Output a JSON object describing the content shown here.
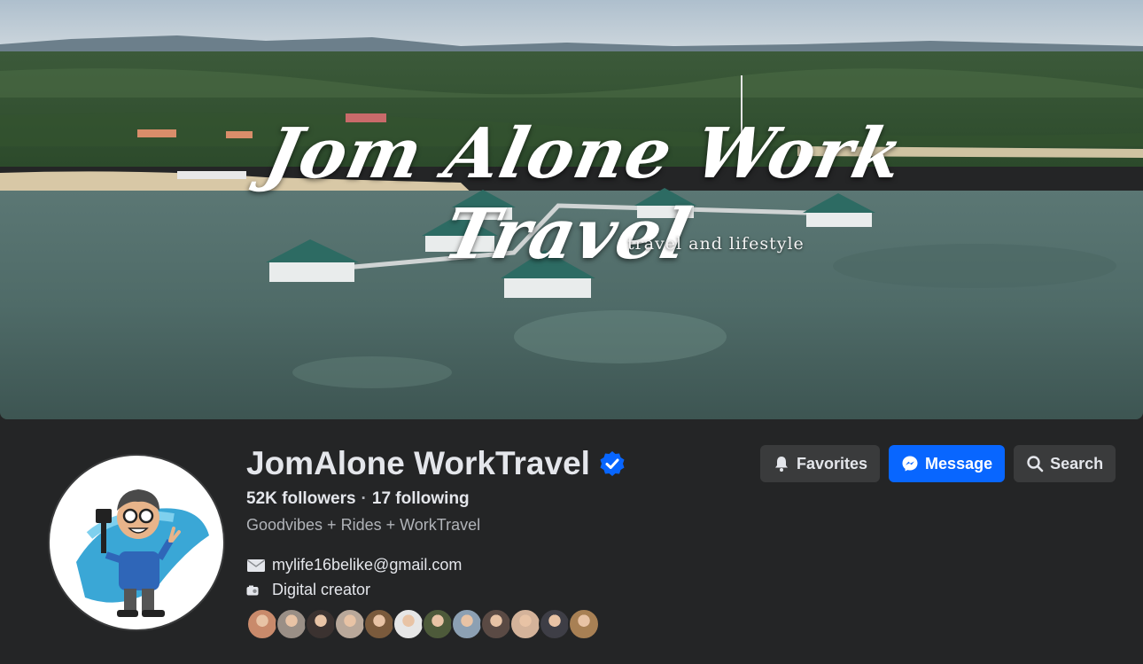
{
  "cover": {
    "title": "Jom Alone Work Travel",
    "subtitle": "travel and lifestyle"
  },
  "profile": {
    "name": "JomAlone WorkTravel",
    "followers": "52K followers",
    "following": "17 following",
    "bio": "Goodvibes + Rides + WorkTravel",
    "email": "mylife16belike@gmail.com",
    "category": "Digital creator"
  },
  "actions": {
    "favorites": "Favorites",
    "message": "Message",
    "search": "Search"
  },
  "friend_avatar_colors": [
    "#c98a6b",
    "#9a8f86",
    "#3b3230",
    "#b9a89a",
    "#7a5a3c",
    "#e6e6e6",
    "#4d5a3a",
    "#8ca0b3",
    "#5a4a44",
    "#d4b39a",
    "#3e3e46",
    "#a88054"
  ],
  "colors": {
    "accent": "#0866ff",
    "verified": "#0866ff",
    "background": "#242526",
    "button": "#3a3b3c"
  }
}
